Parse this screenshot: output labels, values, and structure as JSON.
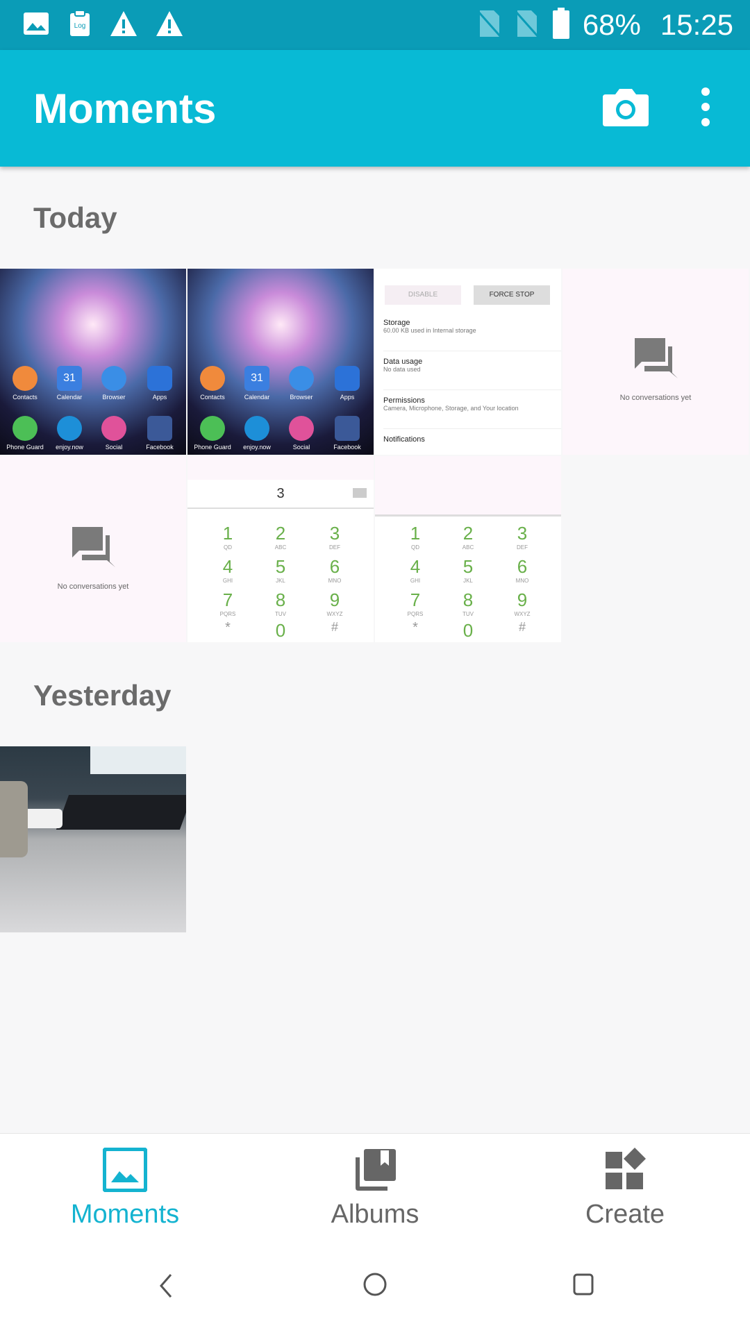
{
  "status_bar": {
    "battery": "68%",
    "time": "15:25",
    "left_icons": [
      "image-icon",
      "log-icon",
      "warning-icon",
      "warning-icon"
    ],
    "right_icons": [
      "no-sim-icon",
      "no-sim-icon",
      "battery-icon"
    ]
  },
  "app_bar": {
    "title": "Moments",
    "actions": [
      "camera-icon",
      "more-vert-icon"
    ]
  },
  "sections": [
    {
      "title": "Today"
    },
    {
      "title": "Yesterday"
    }
  ],
  "thumbs": {
    "home": {
      "apps_row1": [
        "Contacts",
        "Calendar",
        "Browser",
        "Apps"
      ],
      "apps_row2": [
        "Phone Guard",
        "enjoy.now",
        "Social",
        "Facebook"
      ],
      "calendar_day": "31"
    },
    "settings": {
      "disable": "DISABLE",
      "force_stop": "FORCE STOP",
      "rows": [
        {
          "title": "Storage",
          "sub": "60.00 KB used in Internal storage"
        },
        {
          "title": "Data usage",
          "sub": "No data used"
        },
        {
          "title": "Permissions",
          "sub": "Camera, Microphone, Storage, and Your location"
        },
        {
          "title": "Notifications",
          "sub": ""
        }
      ]
    },
    "messages": {
      "empty": "No conversations yet"
    },
    "dialer": {
      "entered": "3",
      "keys": [
        {
          "d": "1",
          "l": "QD"
        },
        {
          "d": "2",
          "l": "ABC"
        },
        {
          "d": "3",
          "l": "DEF"
        },
        {
          "d": "4",
          "l": "GHI"
        },
        {
          "d": "5",
          "l": "JKL"
        },
        {
          "d": "6",
          "l": "MNO"
        },
        {
          "d": "7",
          "l": "PQRS"
        },
        {
          "d": "8",
          "l": "TUV"
        },
        {
          "d": "9",
          "l": "WXYZ"
        },
        {
          "d": "*",
          "l": ""
        },
        {
          "d": "0",
          "l": ""
        },
        {
          "d": "#",
          "l": ""
        }
      ]
    }
  },
  "bottom_nav": {
    "items": [
      {
        "label": "Moments",
        "icon": "photo-icon",
        "active": true
      },
      {
        "label": "Albums",
        "icon": "albums-icon",
        "active": false
      },
      {
        "label": "Create",
        "icon": "create-icon",
        "active": false
      }
    ]
  },
  "colors": {
    "status_bar": "#0a9cb7",
    "app_bar": "#08bad5",
    "active": "#14b3d0",
    "inactive": "#666666"
  }
}
